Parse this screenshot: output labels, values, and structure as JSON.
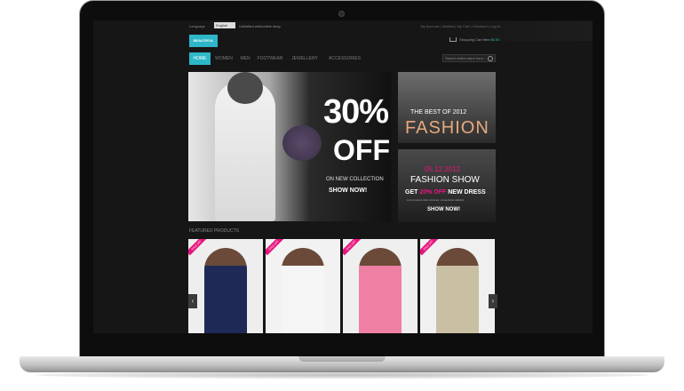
{
  "topbar": {
    "language_label": "Language",
    "language_value": "English",
    "unlimited_text": "Unlimited web/online shop",
    "account_links": "My Account | Wishlist | My Cart | Checkout | Log In"
  },
  "header": {
    "logo_text": "BEAUTIFUL",
    "cart_label": "Shopping Cart item",
    "cart_total": "$0.00"
  },
  "nav": {
    "items": [
      "HOME",
      "WOMEN",
      "MEN",
      "FOOTWEAR",
      "JEWELLERY",
      "ACCESSORIES"
    ],
    "active_index": 0
  },
  "search": {
    "placeholder": "Search entire store here..."
  },
  "hero": {
    "percent": "30%",
    "off": "OFF",
    "subtitle": "ON NEW COLLECTION",
    "cta": "SHOW NOW!"
  },
  "banner1": {
    "top_line": "THE BEST OF 2012",
    "main": "FASHION"
  },
  "banner2": {
    "date": "05.12.2012",
    "title": "FASHION SHOW",
    "offer_pre": "GET ",
    "offer_pct": "20% OFF",
    "offer_post": " NEW DRESS",
    "small": "Lorem ipsum dolor sit amet, consectetur adipisic",
    "cta": "SHOW NOW!"
  },
  "featured": {
    "title": "FEATURED PRODUCTS",
    "sale_label": "SALE OFF",
    "products": [
      {
        "bg": "#eeeeee",
        "outfit": "#1e2a55"
      },
      {
        "bg": "#f2f2f2",
        "outfit": "#f5f5f5"
      },
      {
        "bg": "#efefef",
        "outfit": "#ef7fa3"
      },
      {
        "bg": "#f0f0f0",
        "outfit": "#c9bfa3"
      }
    ]
  },
  "colors": {
    "accent": "#2eb7c8",
    "pink": "#e8157e",
    "background": "#161616"
  }
}
